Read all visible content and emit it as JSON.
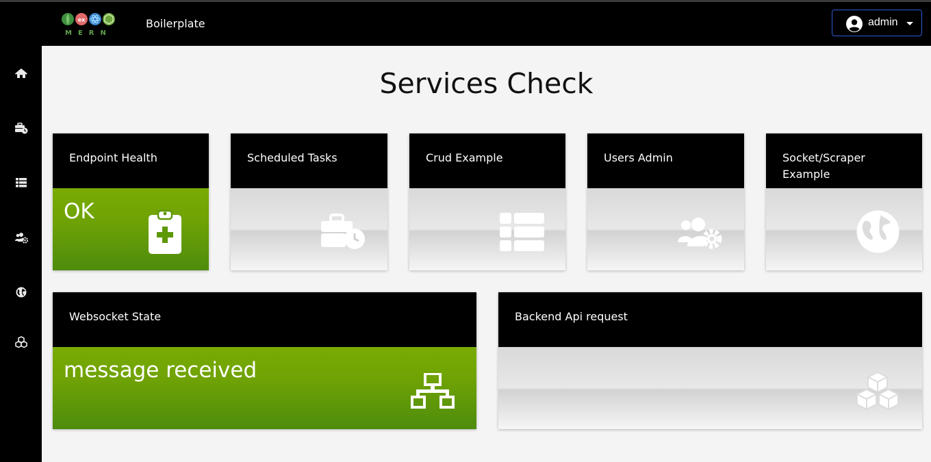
{
  "navbar": {
    "logo_text": "MERN",
    "brand": "Boilerplate",
    "user_label": "admin"
  },
  "sidebar": {
    "items": [
      {
        "icon": "home-icon"
      },
      {
        "icon": "business-time-icon"
      },
      {
        "icon": "table-list-icon"
      },
      {
        "icon": "users-cog-icon"
      },
      {
        "icon": "globe-icon"
      },
      {
        "icon": "cubes-icon"
      }
    ]
  },
  "page": {
    "title": "Services Check"
  },
  "cards": {
    "endpoint_health": {
      "title": "Endpoint Health",
      "status": "OK",
      "icon": "clipboard-medical-icon"
    },
    "scheduled_tasks": {
      "title": "Scheduled Tasks",
      "icon": "business-time-icon"
    },
    "crud_example": {
      "title": "Crud Example",
      "icon": "table-list-icon"
    },
    "users_admin": {
      "title": "Users Admin",
      "icon": "users-cog-icon"
    },
    "socket_scraper": {
      "title": "Socket/Scraper Example",
      "icon": "globe-icon"
    },
    "websocket_state": {
      "title": "Websocket State",
      "status": "message received",
      "icon": "network-icon"
    },
    "backend_api": {
      "title": "Backend Api request",
      "icon": "cubes-icon"
    }
  },
  "colors": {
    "ok_green": "#79ab03",
    "header_black": "#000000",
    "button_border": "#2f5bd7"
  }
}
